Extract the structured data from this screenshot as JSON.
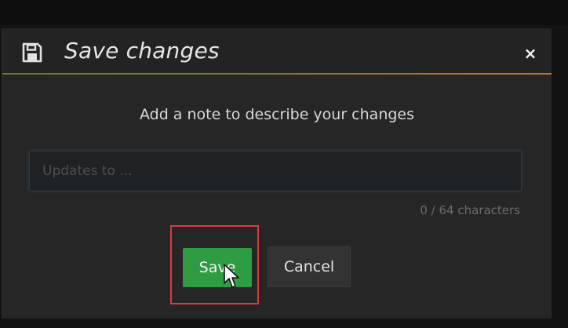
{
  "dialog": {
    "title": "Save changes",
    "title_icon": "save-icon",
    "close_label": "×",
    "prompt": "Add a note to describe your changes",
    "note_input": {
      "value": "",
      "placeholder": "Updates to ..."
    },
    "char_counter": "0 / 64 characters",
    "buttons": {
      "save_label": "Save",
      "cancel_label": "Cancel"
    }
  },
  "colors": {
    "save_button": "#2e9c43",
    "highlight": "#e0393a",
    "header_accent": "#c07a20"
  }
}
